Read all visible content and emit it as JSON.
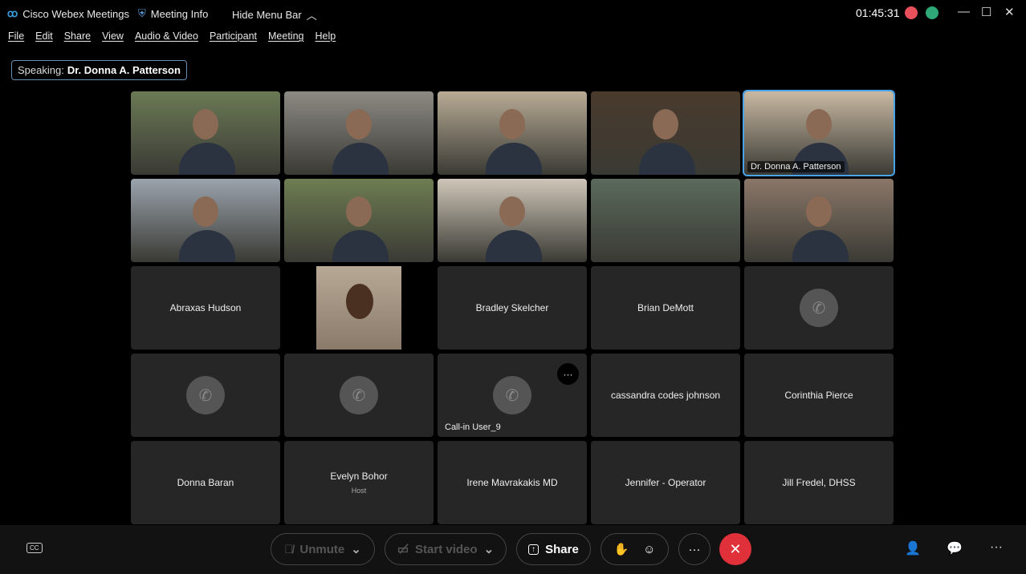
{
  "titlebar": {
    "app": "Cisco Webex Meetings",
    "meeting_info": "Meeting Info",
    "hide_menu": "Hide Menu Bar",
    "clock": "01:45:31",
    "record_color": "#e8505b",
    "network_color": "#2ea876"
  },
  "menu": [
    "File",
    "Edit",
    "Share",
    "View",
    "Audio & Video",
    "Participant",
    "Meeting",
    "Help"
  ],
  "speaking": {
    "label": "Speaking:",
    "name": "Dr. Donna A. Patterson"
  },
  "tiles": [
    {
      "type": "video",
      "bg": "#6b7a55"
    },
    {
      "type": "video",
      "bg": "#8d8a84"
    },
    {
      "type": "video",
      "bg": "#b8ab95"
    },
    {
      "type": "video",
      "bg": "#4a3a2c"
    },
    {
      "type": "video",
      "bg": "#c9b9a3",
      "label": "Dr. Donna A. Patterson",
      "active": true
    },
    {
      "type": "video",
      "bg": "#9aa3ad"
    },
    {
      "type": "video",
      "bg": "#6e7d52"
    },
    {
      "type": "video",
      "bg": "#cfc6b8"
    },
    {
      "type": "blank",
      "bg": "#5a6a5c"
    },
    {
      "type": "video",
      "bg": "#8a7768"
    },
    {
      "type": "name",
      "name": "Abraxas Hudson"
    },
    {
      "type": "video-narrow",
      "bg": "#8a7a6a"
    },
    {
      "type": "name",
      "name": "Bradley Skelcher"
    },
    {
      "type": "name",
      "name": "Brian DeMott"
    },
    {
      "type": "phone"
    },
    {
      "type": "phone"
    },
    {
      "type": "phone"
    },
    {
      "type": "phone",
      "name": "Call-in User_9",
      "more": "···"
    },
    {
      "type": "name",
      "name": "cassandra codes johnson"
    },
    {
      "type": "name",
      "name": "Corinthia Pierce"
    },
    {
      "type": "name",
      "name": "Donna Baran"
    },
    {
      "type": "name",
      "name": "Evelyn Bohor",
      "role": "Host"
    },
    {
      "type": "name",
      "name": "Irene Mavrakakis MD"
    },
    {
      "type": "name",
      "name": "Jennifer - Operator"
    },
    {
      "type": "name",
      "name": "Jill Fredel, DHSS"
    }
  ],
  "controls": {
    "unmute": "Unmute",
    "start_video": "Start video",
    "share": "Share",
    "more": "···",
    "end_color": "#e0303a"
  }
}
